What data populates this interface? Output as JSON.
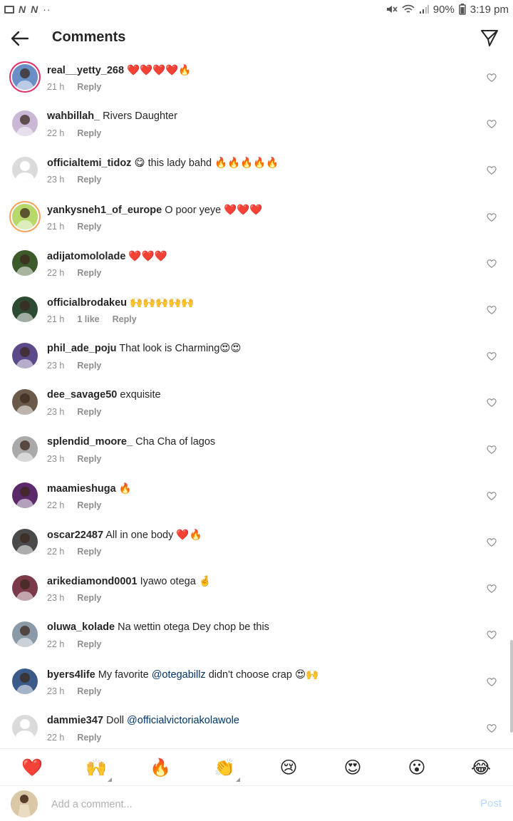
{
  "status_bar": {
    "left_icons": [
      "gallery-icon",
      "n-icon",
      "n-icon"
    ],
    "left_dots": "··",
    "battery": "90%",
    "time": "3:19 pm"
  },
  "header": {
    "title": "Comments"
  },
  "comments": [
    {
      "user": "real__yetty_268",
      "text": "❤️❤️❤️❤️🔥",
      "time": "21 h",
      "likes": "",
      "reply": "Reply",
      "avatar": "ring"
    },
    {
      "user": "wahbillah_",
      "text": "Rivers Daughter",
      "time": "22 h",
      "likes": "",
      "reply": "Reply",
      "avatar": "photo"
    },
    {
      "user": "officialtemi_tidoz",
      "text": "😋 this lady bahd 🔥🔥🔥🔥🔥",
      "time": "23 h",
      "likes": "",
      "reply": "Reply",
      "avatar": "default"
    },
    {
      "user": "yankysneh1_of_europe",
      "text": "O poor yeye ❤️❤️❤️",
      "time": "21 h",
      "likes": "",
      "reply": "Reply",
      "avatar": "ring-y"
    },
    {
      "user": "adijatomololade",
      "text": "❤️❤️❤️",
      "time": "22 h",
      "likes": "",
      "reply": "Reply",
      "avatar": "photo"
    },
    {
      "user": "officialbrodakeu",
      "text": "🙌🙌🙌🙌🙌",
      "time": "21 h",
      "likes": "1 like",
      "reply": "Reply",
      "avatar": "photo"
    },
    {
      "user": "phil_ade_poju",
      "text": "That look is Charming😍😍",
      "time": "23 h",
      "likes": "",
      "reply": "Reply",
      "avatar": "photo"
    },
    {
      "user": "dee_savage50",
      "text": "exquisite",
      "time": "23 h",
      "likes": "",
      "reply": "Reply",
      "avatar": "photo"
    },
    {
      "user": "splendid_moore_",
      "text": "Cha Cha of lagos",
      "time": "23 h",
      "likes": "",
      "reply": "Reply",
      "avatar": "photo"
    },
    {
      "user": "maamieshuga",
      "text": "🔥",
      "time": "22 h",
      "likes": "",
      "reply": "Reply",
      "avatar": "photo"
    },
    {
      "user": "oscar22487",
      "text": "All in one body ❤️🔥",
      "time": "22 h",
      "likes": "",
      "reply": "Reply",
      "avatar": "photo"
    },
    {
      "user": "arikediamond0001",
      "text": "Iyawo otega 🤞",
      "time": "23 h",
      "likes": "",
      "reply": "Reply",
      "avatar": "photo"
    },
    {
      "user": "oluwa_kolade",
      "text": "Na wettin otega Dey chop be this",
      "time": "22 h",
      "likes": "",
      "reply": "Reply",
      "avatar": "photo"
    },
    {
      "user": "byers4life",
      "text_before": "My favorite ",
      "mention": "@otegabillz",
      "text_after": "  didn't choose crap 😍🙌",
      "time": "23 h",
      "likes": "",
      "reply": "Reply",
      "avatar": "photo"
    },
    {
      "user": "dammie347",
      "text_before": "Doll ",
      "mention": "@officialvictoriakolawole",
      "text_after": "",
      "time": "22 h",
      "likes": "",
      "reply": "Reply",
      "avatar": "default"
    }
  ],
  "avatar_colors": [
    "#6a8fc7",
    "#c9b9d6",
    "#dbdbdb",
    "#b7d86a",
    "#3d5a2a",
    "#2d4a32",
    "#5b4a8a",
    "#6b5a4a",
    "#a9a9a9",
    "#5a2a6a",
    "#4a4a4a",
    "#7a3a4a",
    "#8a9aa9",
    "#3a5a8a",
    "#dbdbdb"
  ],
  "emoji_bar": [
    {
      "emoji": "❤️",
      "name": "heart-emoji",
      "has_variants": false
    },
    {
      "emoji": "🙌",
      "name": "raised-hands-emoji",
      "has_variants": true
    },
    {
      "emoji": "🔥",
      "name": "fire-emoji",
      "has_variants": false
    },
    {
      "emoji": "👏",
      "name": "clapping-emoji",
      "has_variants": true
    },
    {
      "emoji": "😢",
      "name": "crying-emoji",
      "has_variants": false
    },
    {
      "emoji": "😍",
      "name": "heart-eyes-emoji",
      "has_variants": false
    },
    {
      "emoji": "😮",
      "name": "surprised-emoji",
      "has_variants": false
    },
    {
      "emoji": "😂",
      "name": "laughing-emoji",
      "has_variants": false
    }
  ],
  "input": {
    "placeholder": "Add a comment...",
    "value": "",
    "post_label": "Post",
    "post_color": "#b3dbff"
  },
  "accent": "#0095f6",
  "mention_color": "#003569"
}
